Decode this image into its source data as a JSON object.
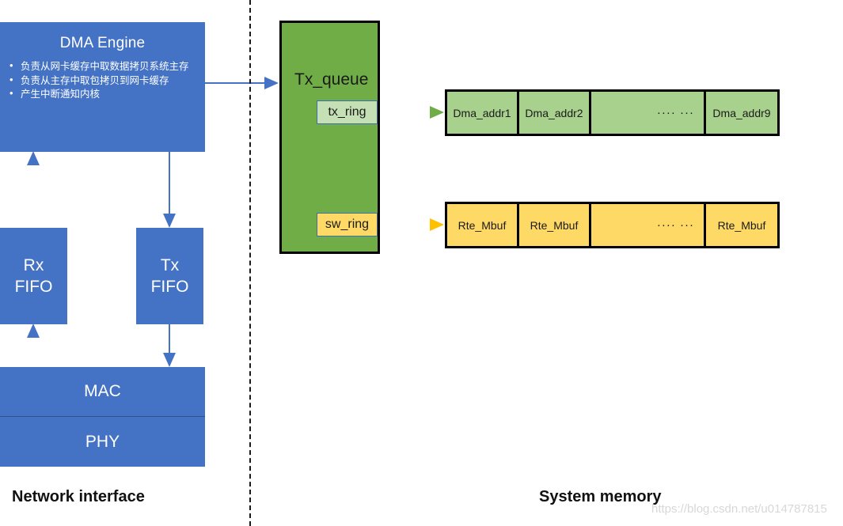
{
  "diagram": {
    "left_section": {
      "caption": "Network interface",
      "dma": {
        "title": "DMA Engine",
        "bullets": [
          "负责从网卡缓存中取数据拷贝系统主存",
          "负责从主存中取包拷贝到网卡缓存",
          "产生中断通知内核"
        ]
      },
      "rx_fifo": {
        "line1": "Rx",
        "line2": "FIFO"
      },
      "tx_fifo": {
        "line1": "Tx",
        "line2": "FIFO"
      },
      "mac": "MAC",
      "phy": "PHY"
    },
    "right_section": {
      "caption": "System memory",
      "tx_queue": {
        "title": "Tx_queue",
        "tx_ring": "tx_ring",
        "sw_ring": "sw_ring"
      },
      "dma_addr_row": {
        "cells": [
          "Dma_addr1",
          "Dma_addr2",
          "···· ···",
          "Dma_addr9"
        ]
      },
      "mbuf_row": {
        "cells": [
          "Rte_Mbuf",
          "Rte_Mbuf",
          "···· ···",
          "Rte_Mbuf"
        ]
      }
    },
    "watermark": "https://blog.csdn.net/u014787815",
    "colors": {
      "blue": "#4472C4",
      "green": "#70AD47",
      "light_green": "#A9D18E",
      "tx_ring_green": "#C5E0B4",
      "yellow": "#FFD966",
      "border_black": "#000000"
    }
  }
}
